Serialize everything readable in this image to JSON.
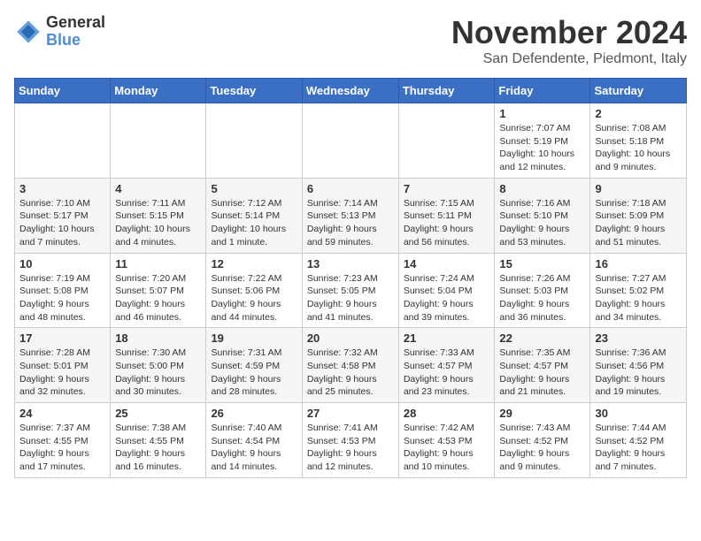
{
  "header": {
    "logo_line1": "General",
    "logo_line2": "Blue",
    "month": "November 2024",
    "location": "San Defendente, Piedmont, Italy"
  },
  "weekdays": [
    "Sunday",
    "Monday",
    "Tuesday",
    "Wednesday",
    "Thursday",
    "Friday",
    "Saturday"
  ],
  "weeks": [
    [
      {
        "day": "",
        "info": ""
      },
      {
        "day": "",
        "info": ""
      },
      {
        "day": "",
        "info": ""
      },
      {
        "day": "",
        "info": ""
      },
      {
        "day": "",
        "info": ""
      },
      {
        "day": "1",
        "info": "Sunrise: 7:07 AM\nSunset: 5:19 PM\nDaylight: 10 hours and 12 minutes."
      },
      {
        "day": "2",
        "info": "Sunrise: 7:08 AM\nSunset: 5:18 PM\nDaylight: 10 hours and 9 minutes."
      }
    ],
    [
      {
        "day": "3",
        "info": "Sunrise: 7:10 AM\nSunset: 5:17 PM\nDaylight: 10 hours and 7 minutes."
      },
      {
        "day": "4",
        "info": "Sunrise: 7:11 AM\nSunset: 5:15 PM\nDaylight: 10 hours and 4 minutes."
      },
      {
        "day": "5",
        "info": "Sunrise: 7:12 AM\nSunset: 5:14 PM\nDaylight: 10 hours and 1 minute."
      },
      {
        "day": "6",
        "info": "Sunrise: 7:14 AM\nSunset: 5:13 PM\nDaylight: 9 hours and 59 minutes."
      },
      {
        "day": "7",
        "info": "Sunrise: 7:15 AM\nSunset: 5:11 PM\nDaylight: 9 hours and 56 minutes."
      },
      {
        "day": "8",
        "info": "Sunrise: 7:16 AM\nSunset: 5:10 PM\nDaylight: 9 hours and 53 minutes."
      },
      {
        "day": "9",
        "info": "Sunrise: 7:18 AM\nSunset: 5:09 PM\nDaylight: 9 hours and 51 minutes."
      }
    ],
    [
      {
        "day": "10",
        "info": "Sunrise: 7:19 AM\nSunset: 5:08 PM\nDaylight: 9 hours and 48 minutes."
      },
      {
        "day": "11",
        "info": "Sunrise: 7:20 AM\nSunset: 5:07 PM\nDaylight: 9 hours and 46 minutes."
      },
      {
        "day": "12",
        "info": "Sunrise: 7:22 AM\nSunset: 5:06 PM\nDaylight: 9 hours and 44 minutes."
      },
      {
        "day": "13",
        "info": "Sunrise: 7:23 AM\nSunset: 5:05 PM\nDaylight: 9 hours and 41 minutes."
      },
      {
        "day": "14",
        "info": "Sunrise: 7:24 AM\nSunset: 5:04 PM\nDaylight: 9 hours and 39 minutes."
      },
      {
        "day": "15",
        "info": "Sunrise: 7:26 AM\nSunset: 5:03 PM\nDaylight: 9 hours and 36 minutes."
      },
      {
        "day": "16",
        "info": "Sunrise: 7:27 AM\nSunset: 5:02 PM\nDaylight: 9 hours and 34 minutes."
      }
    ],
    [
      {
        "day": "17",
        "info": "Sunrise: 7:28 AM\nSunset: 5:01 PM\nDaylight: 9 hours and 32 minutes."
      },
      {
        "day": "18",
        "info": "Sunrise: 7:30 AM\nSunset: 5:00 PM\nDaylight: 9 hours and 30 minutes."
      },
      {
        "day": "19",
        "info": "Sunrise: 7:31 AM\nSunset: 4:59 PM\nDaylight: 9 hours and 28 minutes."
      },
      {
        "day": "20",
        "info": "Sunrise: 7:32 AM\nSunset: 4:58 PM\nDaylight: 9 hours and 25 minutes."
      },
      {
        "day": "21",
        "info": "Sunrise: 7:33 AM\nSunset: 4:57 PM\nDaylight: 9 hours and 23 minutes."
      },
      {
        "day": "22",
        "info": "Sunrise: 7:35 AM\nSunset: 4:57 PM\nDaylight: 9 hours and 21 minutes."
      },
      {
        "day": "23",
        "info": "Sunrise: 7:36 AM\nSunset: 4:56 PM\nDaylight: 9 hours and 19 minutes."
      }
    ],
    [
      {
        "day": "24",
        "info": "Sunrise: 7:37 AM\nSunset: 4:55 PM\nDaylight: 9 hours and 17 minutes."
      },
      {
        "day": "25",
        "info": "Sunrise: 7:38 AM\nSunset: 4:55 PM\nDaylight: 9 hours and 16 minutes."
      },
      {
        "day": "26",
        "info": "Sunrise: 7:40 AM\nSunset: 4:54 PM\nDaylight: 9 hours and 14 minutes."
      },
      {
        "day": "27",
        "info": "Sunrise: 7:41 AM\nSunset: 4:53 PM\nDaylight: 9 hours and 12 minutes."
      },
      {
        "day": "28",
        "info": "Sunrise: 7:42 AM\nSunset: 4:53 PM\nDaylight: 9 hours and 10 minutes."
      },
      {
        "day": "29",
        "info": "Sunrise: 7:43 AM\nSunset: 4:52 PM\nDaylight: 9 hours and 9 minutes."
      },
      {
        "day": "30",
        "info": "Sunrise: 7:44 AM\nSunset: 4:52 PM\nDaylight: 9 hours and 7 minutes."
      }
    ]
  ]
}
